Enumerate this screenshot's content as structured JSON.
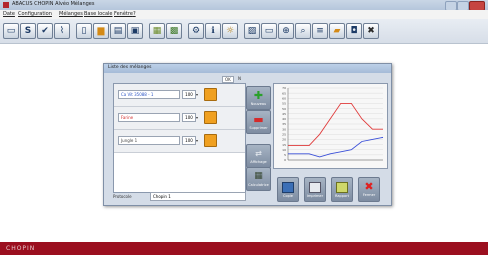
{
  "window": {
    "title": "ABACUS CHOPIN Alvéo Mélanges"
  },
  "menu": [
    "Date",
    "Configuration",
    "Mélanges",
    "Base locale",
    "Fenêtre",
    "?"
  ],
  "toolbar": [
    "monitor-icon",
    "s-icon",
    "check-icon",
    "chart-icon",
    "file-icon",
    "folder-icon",
    "print-icon",
    "save-icon",
    "tools-icon",
    "grid-icon",
    "gear-icon",
    "info-icon",
    "bulb-icon",
    "graph-icon",
    "doc-icon",
    "zoom-icon",
    "search-icon",
    "list-icon",
    "export-icon",
    "camera-icon",
    "close-icon"
  ],
  "dialog": {
    "title": "Liste des mélanges",
    "top_label": "OK",
    "top_value": "N",
    "rows": [
      {
        "name": "Ca Vit 35088 - 1",
        "pct": "100",
        "color": "#2b55c5"
      },
      {
        "name": "Farine",
        "pct": "100",
        "color": "#d22a2a"
      },
      {
        "name": "Jungle 1",
        "pct": "100",
        "color": "#444444"
      }
    ],
    "buttons": {
      "add": "Nouveau",
      "remove": "Supprimer",
      "view": "Affichage",
      "calc": "Calculatrice"
    },
    "patient_label": "Protocole",
    "patient_value": "Chopin 1",
    "bottom": {
      "screen": "Copie",
      "print": "Imprimer",
      "doc": "Rapport",
      "close": "Fermer"
    }
  },
  "chart_data": {
    "type": "line",
    "ylim": [
      0,
      70
    ],
    "y_ticks": [
      "70",
      "65",
      "60",
      "55",
      "50",
      "45",
      "40",
      "35",
      "30",
      "25",
      "20",
      "15",
      "10",
      "5",
      "0"
    ],
    "x": [
      0,
      5,
      10,
      15,
      20,
      25,
      30,
      35,
      40,
      45
    ],
    "series": [
      {
        "color": "#e03a3a",
        "values": [
          14,
          14,
          14,
          25,
          40,
          55,
          55,
          40,
          30,
          30
        ]
      },
      {
        "color": "#3a4fd8",
        "values": [
          6,
          6,
          6,
          3,
          6,
          8,
          10,
          18,
          20,
          22
        ]
      }
    ]
  }
}
